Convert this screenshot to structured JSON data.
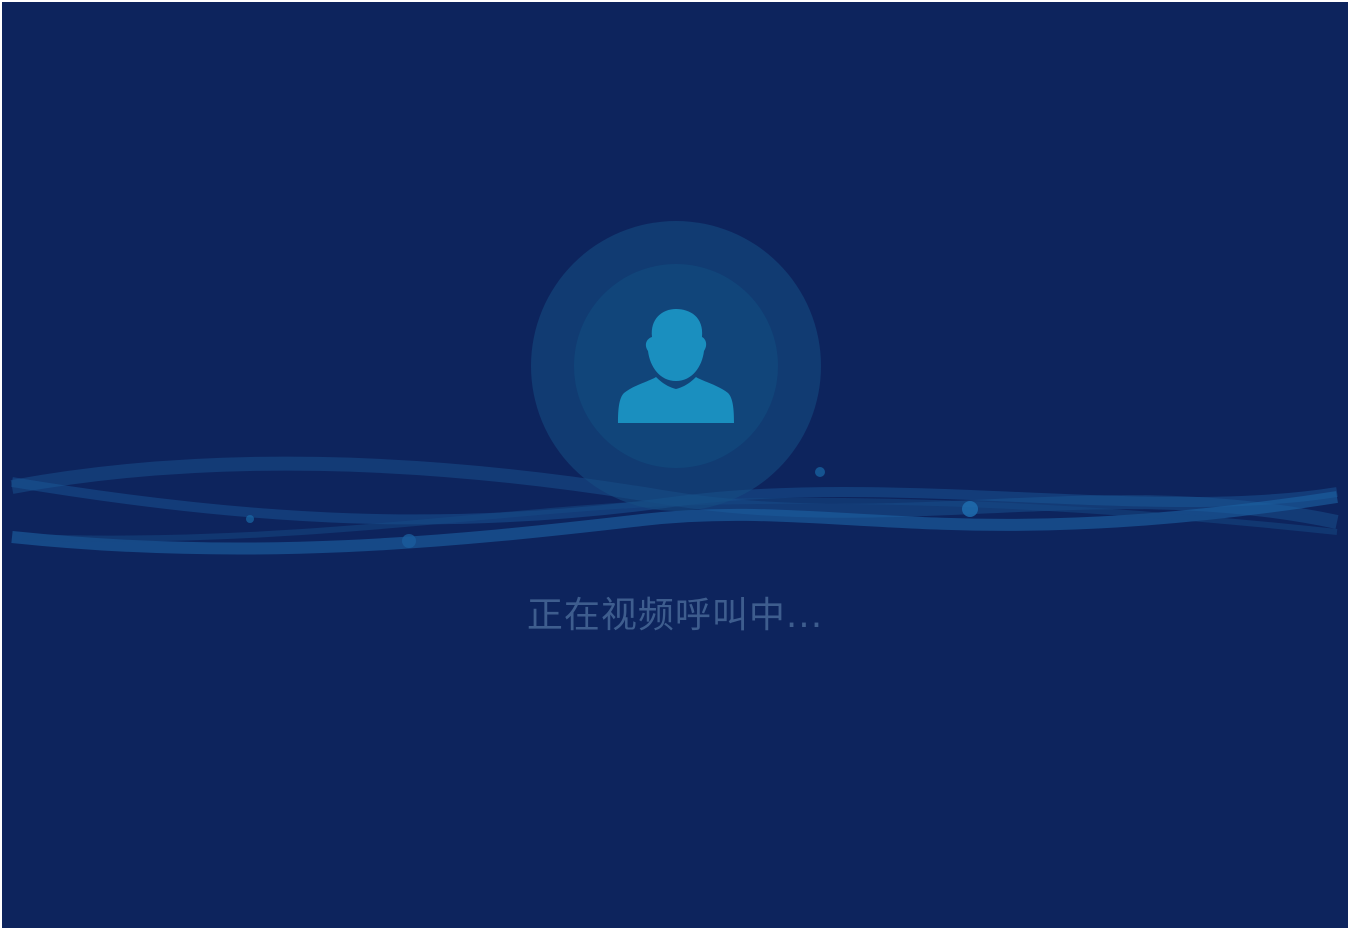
{
  "call": {
    "status_text": "正在视频呼叫中...",
    "avatar_icon": "person-silhouette-icon"
  },
  "colors": {
    "background": "#0d245d",
    "avatar_ring_outer": "#164e84",
    "avatar_ring_inner": "#11457a",
    "avatar_icon": "#1a8fbf",
    "status_text": "#3e5d8e",
    "wave": "#1a5c9c"
  }
}
